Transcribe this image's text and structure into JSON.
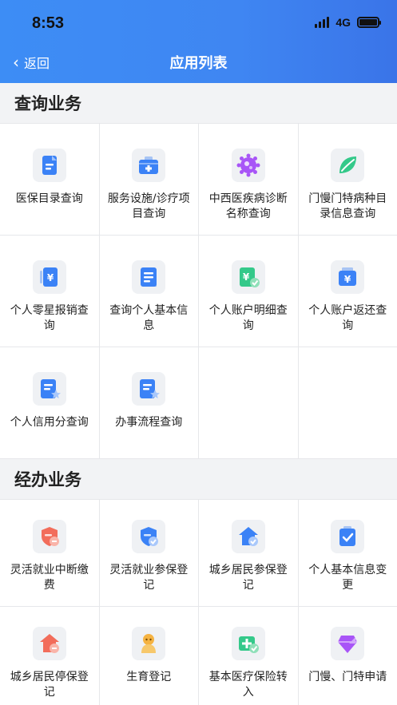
{
  "status": {
    "time": "8:53",
    "network": "4G"
  },
  "nav": {
    "back_label": "返回",
    "title": "应用列表"
  },
  "sections": [
    {
      "title": "查询业务",
      "items": [
        {
          "label": "医保目录查询",
          "icon": "document-icon",
          "color": "#3b82f6"
        },
        {
          "label": "服务设施/诊疗项目查询",
          "icon": "medical-kit-icon",
          "color": "#3b82f6"
        },
        {
          "label": "中西医疾病诊断名称查询",
          "icon": "virus-icon",
          "color": "#a855f7"
        },
        {
          "label": "门慢门特病种目录信息查询",
          "icon": "leaf-icon",
          "color": "#34c98a"
        },
        {
          "label": "个人零星报销查询",
          "icon": "receipt-yen-icon",
          "color": "#3b82f6"
        },
        {
          "label": "查询个人基本信息",
          "icon": "form-icon",
          "color": "#3b82f6"
        },
        {
          "label": "个人账户明细查询",
          "icon": "account-yen-check-icon",
          "color": "#34c98a"
        },
        {
          "label": "个人账户返还查询",
          "icon": "wallet-yen-icon",
          "color": "#3b82f6"
        },
        {
          "label": "个人信用分查询",
          "icon": "document-star-icon",
          "color": "#3b82f6"
        },
        {
          "label": "办事流程查询",
          "icon": "document-star-icon",
          "color": "#3b82f6"
        }
      ]
    },
    {
      "title": "经办业务",
      "items": [
        {
          "label": "灵活就业中断缴费",
          "icon": "shield-minus-icon",
          "color": "#f26d5b"
        },
        {
          "label": "灵活就业参保登记",
          "icon": "shield-check-icon",
          "color": "#3b82f6"
        },
        {
          "label": "城乡居民参保登记",
          "icon": "house-check-icon",
          "color": "#3b82f6"
        },
        {
          "label": "个人基本信息变更",
          "icon": "clipboard-check-icon",
          "color": "#3b82f6"
        },
        {
          "label": "城乡居民停保登记",
          "icon": "house-minus-icon",
          "color": "#f26d5b"
        },
        {
          "label": "生育登记",
          "icon": "baby-icon",
          "color": "#f5b342"
        },
        {
          "label": "基本医疗保险转入",
          "icon": "medical-transfer-icon",
          "color": "#34c98a"
        },
        {
          "label": "门慢、门特申请",
          "icon": "gem-icon",
          "color": "#a855f7"
        }
      ]
    }
  ]
}
